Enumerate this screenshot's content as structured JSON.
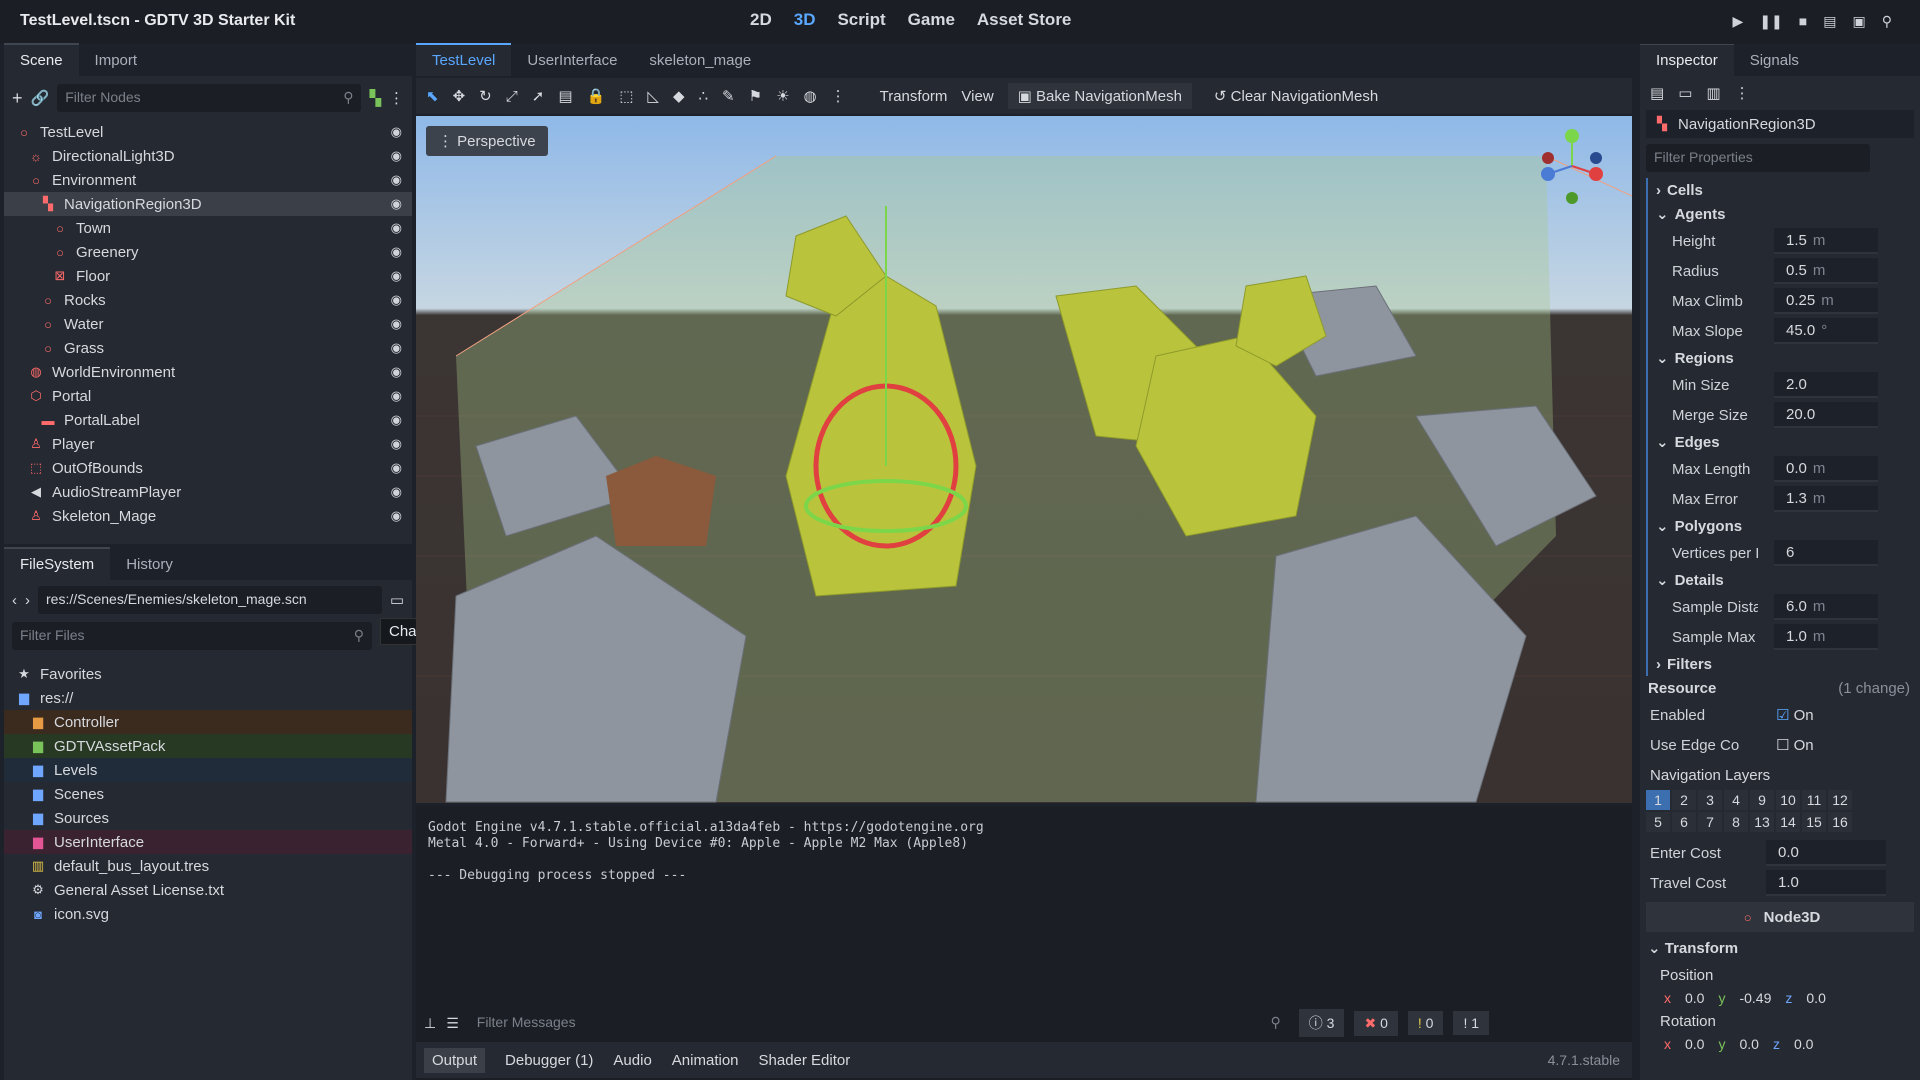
{
  "window": {
    "title": "TestLevel.tscn - GDTV 3D Starter Kit"
  },
  "modes": [
    "2D",
    "3D",
    "Script",
    "Game",
    "Asset Store"
  ],
  "scene": {
    "tabs": [
      "Scene",
      "Import"
    ],
    "filter": "Filter Nodes",
    "nodes": [
      {
        "label": "TestLevel",
        "d": 0,
        "i": "circle",
        "c": "red"
      },
      {
        "label": "DirectionalLight3D",
        "d": 1,
        "i": "sun",
        "c": "red"
      },
      {
        "label": "Environment",
        "d": 1,
        "i": "circle",
        "c": "red"
      },
      {
        "label": "NavigationRegion3D",
        "d": 2,
        "i": "nav",
        "c": "red",
        "sel": true
      },
      {
        "label": "Town",
        "d": 3,
        "i": "circle",
        "c": "red"
      },
      {
        "label": "Greenery",
        "d": 3,
        "i": "circle",
        "c": "red"
      },
      {
        "label": "Floor",
        "d": 3,
        "i": "floor",
        "c": "red"
      },
      {
        "label": "Rocks",
        "d": 2,
        "i": "circle",
        "c": "red"
      },
      {
        "label": "Water",
        "d": 2,
        "i": "circle",
        "c": "red"
      },
      {
        "label": "Grass",
        "d": 2,
        "i": "circle",
        "c": "red"
      },
      {
        "label": "WorldEnvironment",
        "d": 1,
        "i": "globe",
        "c": "red"
      },
      {
        "label": "Portal",
        "d": 1,
        "i": "shield",
        "c": "red"
      },
      {
        "label": "PortalLabel",
        "d": 2,
        "i": "label",
        "c": "red"
      },
      {
        "label": "Player",
        "d": 1,
        "i": "person",
        "c": "red"
      },
      {
        "label": "OutOfBounds",
        "d": 1,
        "i": "area",
        "c": "red"
      },
      {
        "label": "AudioStreamPlayer",
        "d": 1,
        "i": "speaker",
        "c": "white"
      },
      {
        "label": "Skeleton_Mage",
        "d": 1,
        "i": "person",
        "c": "red"
      }
    ]
  },
  "fs": {
    "tabs": [
      "FileSystem",
      "History"
    ],
    "path": "res://Scenes/Enemies/skeleton_mage.scn",
    "filter": "Filter Files",
    "tooltip": "Change Split Mode",
    "items": [
      {
        "label": "Favorites",
        "d": 0,
        "i": "★",
        "c": "white"
      },
      {
        "label": "res://",
        "d": 0,
        "i": "▆",
        "c": "blue"
      },
      {
        "label": "Controller",
        "d": 1,
        "i": "▆",
        "c": "org",
        "bg": "#3b2a1e"
      },
      {
        "label": "GDTVAssetPack",
        "d": 1,
        "i": "▆",
        "c": "grn",
        "bg": "#273823"
      },
      {
        "label": "Levels",
        "d": 1,
        "i": "▆",
        "c": "blue",
        "bg": "#202c3a"
      },
      {
        "label": "Scenes",
        "d": 1,
        "i": "▆",
        "c": "blue",
        "bg": ""
      },
      {
        "label": "Sources",
        "d": 1,
        "i": "▆",
        "c": "blue",
        "bg": ""
      },
      {
        "label": "UserInterface",
        "d": 1,
        "i": "▆",
        "c": "pnk",
        "bg": "#3a2230"
      },
      {
        "label": "default_bus_layout.tres",
        "d": 1,
        "i": "▥",
        "c": "yel",
        "bg": ""
      },
      {
        "label": "General Asset License.txt",
        "d": 1,
        "i": "⚙",
        "c": "white",
        "bg": ""
      },
      {
        "label": "icon.svg",
        "d": 1,
        "i": "◙",
        "c": "blue",
        "bg": ""
      }
    ]
  },
  "editor": {
    "tabs": [
      "TestLevel",
      "UserInterface",
      "skeleton_mage"
    ],
    "toolbar": [
      "Transform",
      "View",
      "Bake NavigationMesh",
      "Clear NavigationMesh"
    ],
    "perspective": "Perspective"
  },
  "output": {
    "lines": [
      "Godot Engine v4.7.1.stable.official.a13da4feb - https://godotengine.org",
      "Metal 4.0 - Forward+ - Using Device #0: Apple - Apple M2 Max (Apple8)",
      "",
      "--- Debugging process stopped ---"
    ],
    "filter": "Filter Messages",
    "counts": [
      "3",
      "0",
      "0",
      "1"
    ],
    "tabs": [
      "Output",
      "Debugger (1)",
      "Audio",
      "Animation",
      "Shader Editor"
    ],
    "version": "4.7.1.stable"
  },
  "inspector": {
    "tabs": [
      "Inspector",
      "Signals"
    ],
    "node": "NavigationRegion3D",
    "filter": "Filter Properties",
    "sections": [
      {
        "name": "Cells",
        "props": []
      },
      {
        "name": "Agents",
        "props": [
          [
            "Height",
            "1.5",
            "m"
          ],
          [
            "Radius",
            "0.5",
            "m"
          ],
          [
            "Max Climb",
            "0.25",
            "m"
          ],
          [
            "Max Slope",
            "45.0",
            "°"
          ]
        ]
      },
      {
        "name": "Regions",
        "props": [
          [
            "Min Size",
            "2.0",
            ""
          ],
          [
            "Merge Size",
            "20.0",
            ""
          ]
        ]
      },
      {
        "name": "Edges",
        "props": [
          [
            "Max Length",
            "0.0",
            "m"
          ],
          [
            "Max Error",
            "1.3",
            "m"
          ]
        ]
      },
      {
        "name": "Polygons",
        "props": [
          [
            "Vertices per Po",
            "6",
            ""
          ]
        ]
      },
      {
        "name": "Details",
        "props": [
          [
            "Sample Distanc",
            "6.0",
            "m"
          ],
          [
            "Sample Max Er",
            "1.0",
            "m"
          ]
        ]
      },
      {
        "name": "Filters",
        "props": []
      }
    ],
    "resource": "Resource",
    "change": "(1 change)",
    "enabled": "Enabled",
    "on": "On",
    "edge": "Use Edge Co",
    "navlayers": "Navigation Layers",
    "layers": [
      "1",
      "2",
      "3",
      "4",
      "9",
      "10",
      "11",
      "12",
      "5",
      "6",
      "7",
      "8",
      "13",
      "14",
      "15",
      "16"
    ],
    "enter": [
      "Enter Cost",
      "0.0"
    ],
    "travel": [
      "Travel Cost",
      "1.0"
    ],
    "node3d": "Node3D",
    "transform": "Transform",
    "position": "Position",
    "pos": [
      "0.0",
      "-0.49",
      "0.0"
    ],
    "rotation": "Rotation",
    "rot": [
      "0.0",
      "0.0",
      "0.0"
    ]
  }
}
